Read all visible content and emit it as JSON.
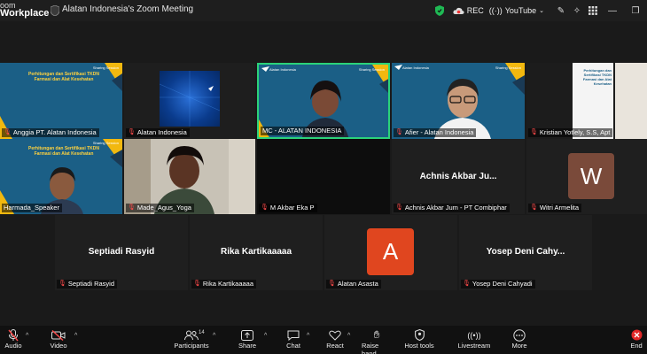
{
  "app": {
    "brand_line1": "oom",
    "brand_line2": "Workplace",
    "meeting_title": "Alatan Indonesia's Zoom Meeting"
  },
  "titlebar": {
    "rec_label": "REC",
    "youtube_label": "YouTube"
  },
  "slide": {
    "title": "Perhitungan dan Sertifikasi TKDN Farmasi dan Alat Kesehatan",
    "session": "Sharing Session",
    "org": "Alatan Indonesia",
    "colors": {
      "bg": "#1b5f86",
      "accent": "#ffd23f"
    }
  },
  "participants": [
    {
      "name": "Anggia PT. Alatan Indonesia",
      "muted": true
    },
    {
      "name": "Alatan Indonesia",
      "muted": true
    },
    {
      "name": "MC - ALATAN INDONESIA",
      "muted": false,
      "active_speaker": true
    },
    {
      "name": "Afier - Alatan Indonesia",
      "muted": true
    },
    {
      "name": "Kristian Yotlely, S.S, Apt",
      "muted": true
    },
    {
      "name": "Harmada_Speaker",
      "muted": false
    },
    {
      "name": "Made_Agus_Yoga",
      "muted": true
    },
    {
      "name": "M Akbar Eka P",
      "muted": true
    },
    {
      "name": "Achnis Akbar Jum - PT Combiphar",
      "muted": true,
      "display_name": "Achnis Akbar Ju..."
    },
    {
      "name": "Witri Armelita",
      "muted": true,
      "avatar_letter": "W",
      "avatar_color": "#7a4a3a"
    },
    {
      "name": "Septiadi Rasyid",
      "muted": true,
      "display_name": "Septiadi Rasyid"
    },
    {
      "name": "Rika Kartikaaaaa",
      "muted": true,
      "display_name": "Rika Kartikaaaaa"
    },
    {
      "name": "Alatan Asasta",
      "muted": true,
      "avatar_letter": "A",
      "avatar_color": "#e0461f"
    },
    {
      "name": "Yosep Deni Cahyadi",
      "muted": true,
      "display_name": "Yosep Deni Cahy..."
    }
  ],
  "toolbar": {
    "audio": "Audio",
    "video": "Video",
    "participants": "Participants",
    "participants_count": "14",
    "share": "Share",
    "chat": "Chat",
    "react": "React",
    "raise_hand": "Raise hand",
    "host_tools": "Host tools",
    "livestream": "Livestream",
    "more": "More",
    "end": "End"
  },
  "icons": {
    "shield": "shield-icon",
    "record": "record-cloud-icon",
    "youtube": "youtube-stream-icon"
  }
}
